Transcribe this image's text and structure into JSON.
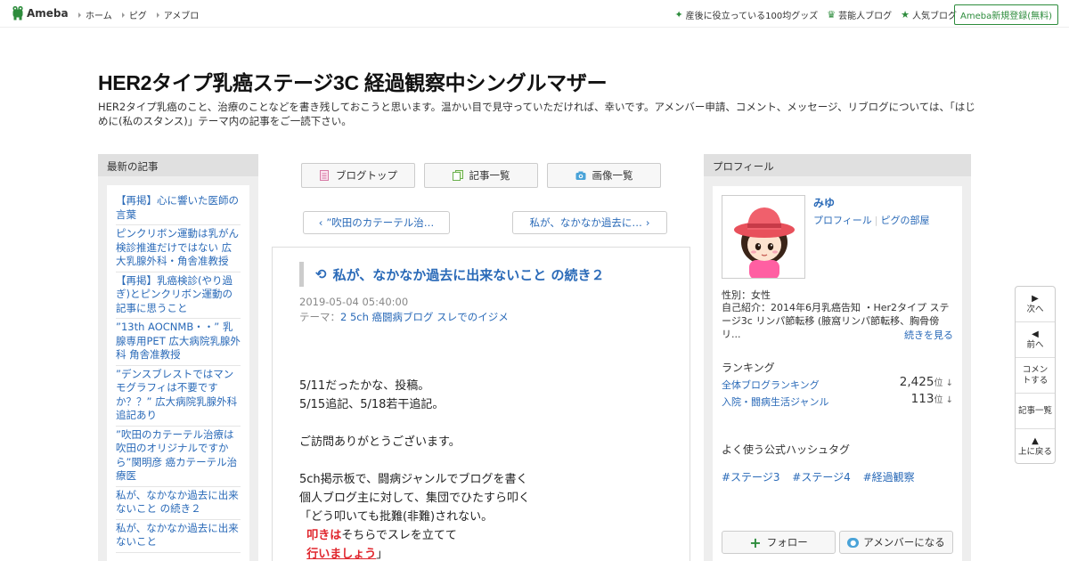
{
  "topbar": {
    "logo": "Ameba",
    "nav": [
      "ホーム",
      "ピグ",
      "アメブロ"
    ],
    "right_links": [
      {
        "icon": "sparkle-icon",
        "label": "産後に役立っている100均グッズ"
      },
      {
        "icon": "crown-icon",
        "label": "芸能人ブログ"
      },
      {
        "icon": "star-icon",
        "label": "人気ブログ"
      }
    ],
    "signup": "Ameba新規登録(無料)"
  },
  "header": {
    "title": "HER2タイプ乳癌ステージ3C 経過観察中シングルマザー",
    "description": "HER2タイプ乳癌のこと、治療のことなどを書き残しておこうと思います。温かい目で見守っていただければ、幸いです。アメンバー申請、コメント、メッセージ、リブログについては、「はじめに(私のスタンス)」テーマ内の記事をご一読下さい。"
  },
  "left_sidebar": {
    "heading": "最新の記事",
    "items": [
      "【再掲】心に響いた医師の言葉",
      "ピンクリボン運動は乳がん検診推進だけではない 広大乳腺外科・角舎准教授",
      "【再掲】乳癌検診(やり過ぎ)とピンクリボン運動の記事に思うこと",
      "”13th AOCNMB・・” 乳腺専用PET 広大病院乳腺外科 角舎准教授",
      "”デンスブレストではマンモグラフィは不要ですか？？” 広大病院乳腺外科追記あり",
      "”吹田のカテーテル治療は吹田のオリジナルですから”関明彦 癌カテーテル治療医",
      "私が、なかなか過去に出来ないこと の続き２",
      "私が、なかなか過去に出来ないこと"
    ]
  },
  "center": {
    "buttons": [
      "ブログトップ",
      "記事一覧",
      "画像一覧"
    ],
    "prev": "”吹田のカテーテル治…",
    "next": "私が、なかなか過去に…",
    "entry_title": "私が、なかなか過去に出来ないこと の続き２",
    "date": "2019-05-04 05:40:00",
    "theme_label": "テーマ：",
    "theme": "2 5ch 癌闘病ブログ スレでのイジメ",
    "body": {
      "l1": "5/11だったかな、投稿。",
      "l2": "5/15追記、5/18若干追記。",
      "l3": "",
      "l4": "ご訪問ありがとうございます。",
      "l5": "",
      "l6": "5ch掲示板で、闘病ジャンルでブログを書く",
      "l7": "個人ブログ主に対して、集団でひたすら叩く",
      "l8": "「どう叩いても批難(非難)されない。",
      "l9a": "叩きは",
      "l9b": "そちらでスレを立てて",
      "l10a": "行いましょう",
      "l10b": "」"
    }
  },
  "profile": {
    "heading": "プロフィール",
    "name": "みゆ",
    "link_profile": "プロフィール",
    "link_room": "ピグの部屋",
    "gender": "性別：女性",
    "intro": "自己紹介：2014年6月乳癌告知 ・Her2タイプ ステージ3c リンパ節転移 (腋窩リンパ節転移、胸骨傍リ...",
    "more": "続きを見る",
    "ranking_heading": "ランキング",
    "rankings": [
      {
        "label": "全体ブログランキング",
        "value": "2,425",
        "unit": "位 ↓"
      },
      {
        "label": "入院・闘病生活ジャンル",
        "value": "113",
        "unit": "位 ↓"
      }
    ],
    "hashtag_heading": "よく使う公式ハッシュタグ",
    "hashtags": [
      "#ステージ3",
      "#ステージ4",
      "#経過観察"
    ],
    "follow": "フォロー",
    "amember": "アメンバーになる"
  },
  "float_nav": {
    "next": "次へ",
    "prev": "前へ",
    "comment": "コメントする",
    "list": "記事一覧",
    "top": "上に戻る"
  }
}
